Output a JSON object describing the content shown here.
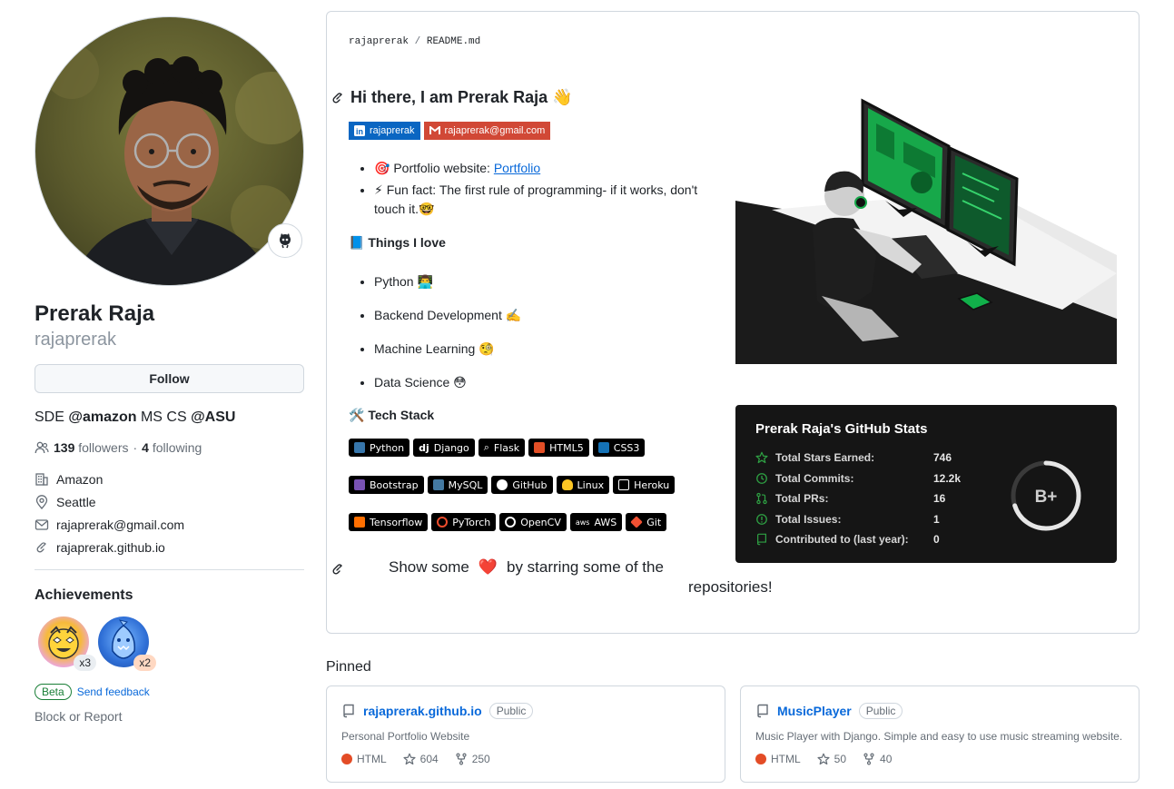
{
  "profile": {
    "name": "Prerak Raja",
    "login": "rajaprerak",
    "follow_label": "Follow",
    "bio_prefix": "SDE ",
    "bio_mention1": "@amazon",
    "bio_mid": " MS CS ",
    "bio_mention2": "@ASU",
    "followers_count": "139",
    "followers_label": "followers",
    "dot": "·",
    "following_count": "4",
    "following_label": "following",
    "company": "Amazon",
    "location": "Seattle",
    "email": "rajaprerak@gmail.com",
    "website": "rajaprerak.github.io"
  },
  "achievements": {
    "title": "Achievements",
    "badges": [
      {
        "name": "starstruck",
        "count": "x3"
      },
      {
        "name": "pull-shark",
        "count": "x2"
      }
    ],
    "beta": "Beta",
    "feedback": "Send feedback"
  },
  "block_report": "Block or Report",
  "readme": {
    "path_user": "rajaprerak",
    "path_sep": "/",
    "path_file": "README.md",
    "heading": "Hi there, I am Prerak Raja 👋",
    "shields": [
      {
        "label": "rajaprerak",
        "color": "#0a66c2",
        "icon": "linkedin-icon"
      },
      {
        "label": "rajaprerak@gmail.com",
        "color": "#d14836",
        "icon": "gmail-icon"
      }
    ],
    "portfolio_prefix": "🎯  Portfolio website: ",
    "portfolio_link": "Portfolio",
    "fun_fact": "⚡  Fun fact: The first rule of programming- if it works, don't touch it.🤓",
    "things_title": "📘 Things I love",
    "things": [
      "Python 👨‍💻",
      "Backend Development ✍️",
      "Machine Learning 🧐",
      "Data Science 😳"
    ],
    "tech_title": "🛠️ Tech Stack",
    "tech_rows": [
      [
        {
          "label": "Python",
          "icon_color": "#3776ab"
        },
        {
          "label": "Django",
          "icon_color": "#ffffff"
        },
        {
          "label": "Flask",
          "icon_color": "#ffffff"
        },
        {
          "label": "HTML5",
          "icon_color": "#e34f26"
        },
        {
          "label": "CSS3",
          "icon_color": "#1572b6"
        }
      ],
      [
        {
          "label": "Bootstrap",
          "icon_color": "#7952b3"
        },
        {
          "label": "MySQL",
          "icon_color": "#4479a1"
        },
        {
          "label": "GitHub",
          "icon_color": "#ffffff"
        },
        {
          "label": "Linux",
          "icon_color": "#fcc624"
        },
        {
          "label": "Heroku",
          "icon_color": "#ffffff"
        }
      ],
      [
        {
          "label": "Tensorflow",
          "icon_color": "#ff6f00"
        },
        {
          "label": "PyTorch",
          "icon_color": "#ee4c2c"
        },
        {
          "label": "OpenCV",
          "icon_color": "#ffffff"
        },
        {
          "label": "AWS",
          "icon_color": "#ffffff"
        },
        {
          "label": "Git",
          "icon_color": "#f05032"
        }
      ]
    ],
    "show_some": "Show some",
    "show_heart": "❤️",
    "show_rest": "by starring some of the",
    "show_line2": "repositories!"
  },
  "github_stats": {
    "title": "Prerak Raja's GitHub Stats",
    "rows": [
      {
        "label": "Total Stars Earned:",
        "value": "746",
        "icon": "star-icon"
      },
      {
        "label": "Total Commits:",
        "value": "12.2k",
        "icon": "history-icon"
      },
      {
        "label": "Total PRs:",
        "value": "16",
        "icon": "pull-request-icon"
      },
      {
        "label": "Total Issues:",
        "value": "1",
        "icon": "issue-icon"
      },
      {
        "label": "Contributed to (last year):",
        "value": "0",
        "icon": "repo-icon"
      }
    ],
    "grade": "B+",
    "grade_progress": 0.7,
    "accent": "#2ea043"
  },
  "pinned": {
    "title": "Pinned",
    "repos": [
      {
        "name": "rajaprerak.github.io",
        "visibility": "Public",
        "description": "Personal Portfolio Website",
        "language": "HTML",
        "language_color": "#e34c26",
        "stars": "604",
        "forks": "250"
      },
      {
        "name": "MusicPlayer",
        "visibility": "Public",
        "description": "Music Player with Django. Simple and easy to use music streaming website.",
        "language": "HTML",
        "language_color": "#e34c26",
        "stars": "50",
        "forks": "40"
      }
    ]
  }
}
